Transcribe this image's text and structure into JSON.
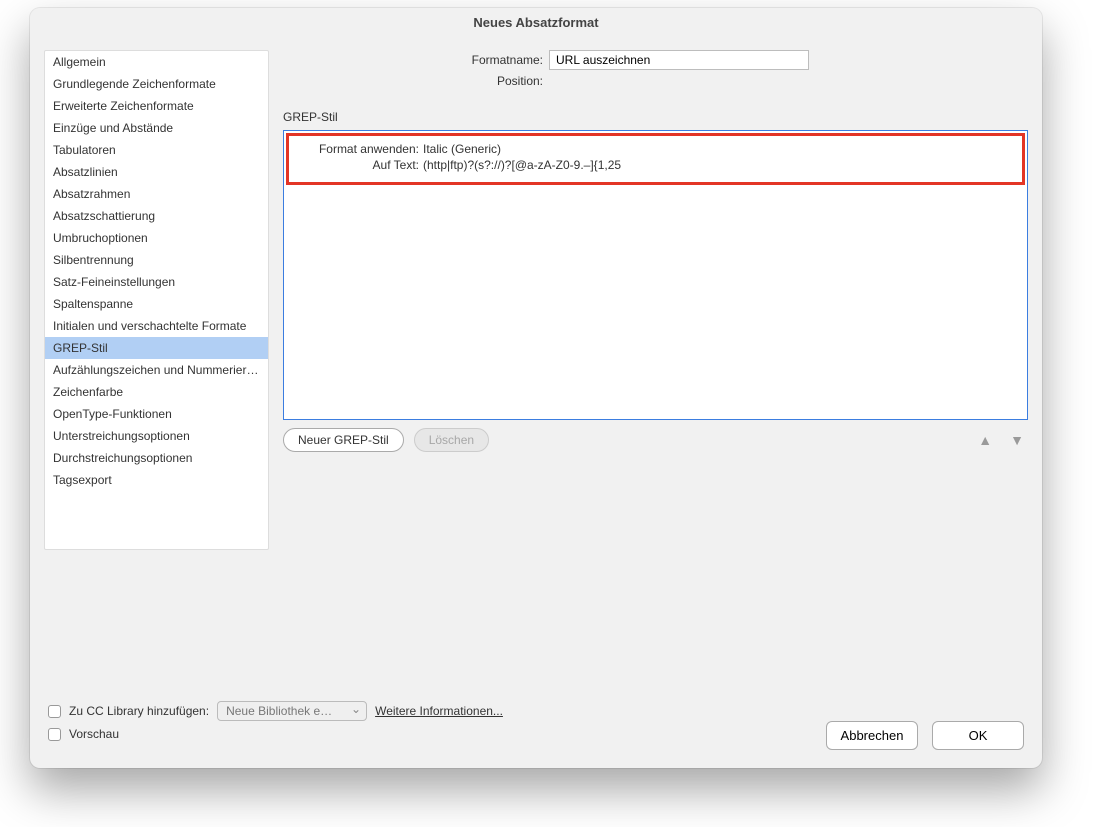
{
  "window": {
    "title": "Neues Absatzformat"
  },
  "sidebar": {
    "items": [
      "Allgemein",
      "Grundlegende Zeichenformate",
      "Erweiterte Zeichenformate",
      "Einzüge und Abstände",
      "Tabulatoren",
      "Absatzlinien",
      "Absatzrahmen",
      "Absatzschattierung",
      "Umbruchoptionen",
      "Silbentrennung",
      "Satz-Feineinstellungen",
      "Spaltenspanne",
      "Initialen und verschachtelte Formate",
      "GREP-Stil",
      "Aufzählungszeichen und Nummerierung",
      "Zeichenfarbe",
      "OpenType-Funktionen",
      "Unterstreichungsoptionen",
      "Durchstreichungsoptionen",
      "Tagsexport"
    ],
    "selected_index": 13
  },
  "form": {
    "name_label": "Formatname:",
    "name_value": "URL auszeichnen",
    "position_label": "Position:"
  },
  "section": {
    "title": "GREP-Stil"
  },
  "grep_entry": {
    "apply_label": "Format anwenden:",
    "apply_value": "Italic (Generic)",
    "text_label": "Auf Text:",
    "text_value": "(http|ftp)?(s?://)?[@a-zA-Z0-9.–]{1,25"
  },
  "buttons": {
    "new": "Neuer GREP-Stil",
    "delete": "Löschen"
  },
  "footer": {
    "cc_label": "Zu CC Library hinzufügen:",
    "cc_select": "Neue Bibliothek e…",
    "more_info": "Weitere Informationen...",
    "preview": "Vorschau",
    "cancel": "Abbrechen",
    "ok": "OK"
  }
}
